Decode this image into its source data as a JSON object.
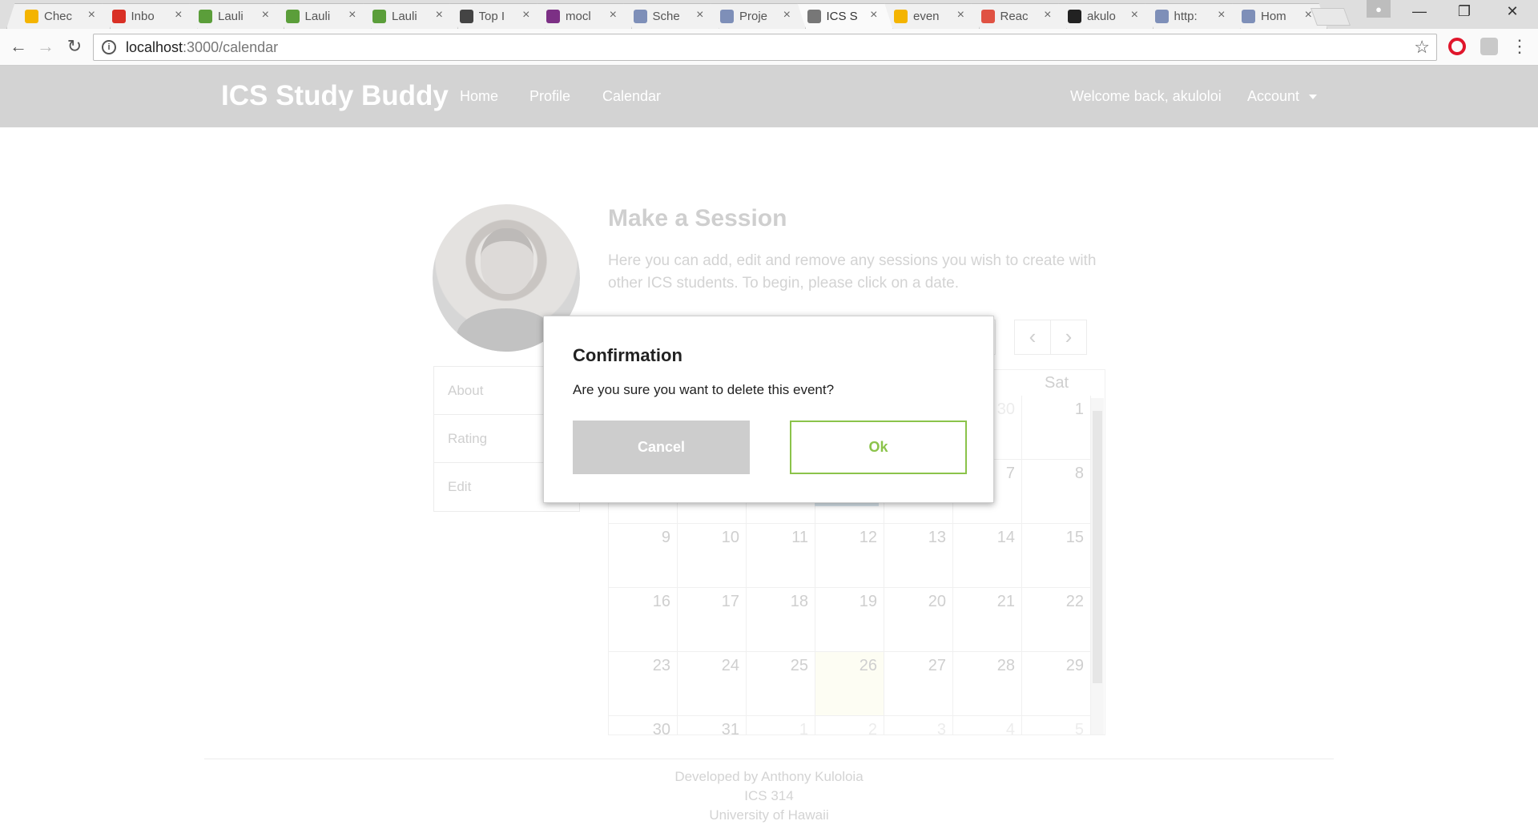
{
  "browser": {
    "tabs": [
      {
        "title": "Chec",
        "icon": "google-drive-icon",
        "color": "#f4b400"
      },
      {
        "title": "Inbo",
        "icon": "gmail-icon",
        "color": "#d93025"
      },
      {
        "title": "Lauli",
        "icon": "leaf-icon",
        "color": "#5b9e3a"
      },
      {
        "title": "Lauli",
        "icon": "leaf-icon",
        "color": "#5b9e3a"
      },
      {
        "title": "Lauli",
        "icon": "leaf-icon",
        "color": "#5b9e3a"
      },
      {
        "title": "Top I",
        "icon": "globe-icon",
        "color": "#444444"
      },
      {
        "title": "mocl",
        "icon": "slack-icon",
        "color": "#7c3085"
      },
      {
        "title": "Sche",
        "icon": "page-icon",
        "color": "#7e8fb8"
      },
      {
        "title": "Proje",
        "icon": "page-icon",
        "color": "#7e8fb8"
      },
      {
        "title": "ICS S",
        "icon": "document-icon",
        "color": "#777777",
        "active": true
      },
      {
        "title": "even",
        "icon": "grid-icon",
        "color": "#f4b400"
      },
      {
        "title": "Reac",
        "icon": "c-icon",
        "color": "#e05243"
      },
      {
        "title": "akulo",
        "icon": "github-icon",
        "color": "#222222"
      },
      {
        "title": "http:",
        "icon": "page-icon",
        "color": "#7e8fb8"
      },
      {
        "title": "Hom",
        "icon": "page-icon",
        "color": "#7e8fb8"
      }
    ],
    "url_host": "localhost",
    "url_path": ":3000/calendar"
  },
  "nav": {
    "brand": "ICS Study Buddy",
    "links": [
      "Home",
      "Profile",
      "Calendar"
    ],
    "welcome": "Welcome back, akuloloi",
    "account": "Account"
  },
  "page": {
    "title": "Make a Session",
    "description": "Here you can add, edit and remove any sessions you wish to create with other ICS students. To begin, please click on a date.",
    "menu": [
      "About",
      "Rating",
      "Edit"
    ]
  },
  "calendar": {
    "visible_day_header": "Sat",
    "weeks": [
      [
        {
          "d": "",
          "o": true
        },
        {
          "d": "",
          "o": true
        },
        {
          "d": "",
          "o": true
        },
        {
          "d": "",
          "o": true
        },
        {
          "d": "",
          "o": true
        },
        {
          "d": "30",
          "o": true
        },
        {
          "d": "1"
        }
      ],
      [
        {
          "d": ""
        },
        {
          "d": ""
        },
        {
          "d": ""
        },
        {
          "d": ""
        },
        {
          "d": ""
        },
        {
          "d": "7"
        },
        {
          "d": "8"
        }
      ],
      [
        {
          "d": "9"
        },
        {
          "d": "10"
        },
        {
          "d": "11"
        },
        {
          "d": "12"
        },
        {
          "d": "13"
        },
        {
          "d": "14"
        },
        {
          "d": "15"
        }
      ],
      [
        {
          "d": "16"
        },
        {
          "d": "17"
        },
        {
          "d": "18"
        },
        {
          "d": "19"
        },
        {
          "d": "20"
        },
        {
          "d": "21"
        },
        {
          "d": "22"
        }
      ],
      [
        {
          "d": "23"
        },
        {
          "d": "24"
        },
        {
          "d": "25"
        },
        {
          "d": "26",
          "today": true
        },
        {
          "d": "27"
        },
        {
          "d": "28"
        },
        {
          "d": "29"
        }
      ],
      [
        {
          "d": "30"
        },
        {
          "d": "31"
        },
        {
          "d": "1",
          "o": true
        },
        {
          "d": "2",
          "o": true
        },
        {
          "d": "3",
          "o": true
        },
        {
          "d": "4",
          "o": true
        },
        {
          "d": "5",
          "o": true
        }
      ]
    ]
  },
  "footer": {
    "line1": "Developed by Anthony Kuloloia",
    "line2": "ICS 314",
    "line3": "University of Hawaii"
  },
  "modal": {
    "title": "Confirmation",
    "message": "Are you sure you want to delete this event?",
    "cancel_label": "Cancel",
    "ok_label": "Ok"
  }
}
